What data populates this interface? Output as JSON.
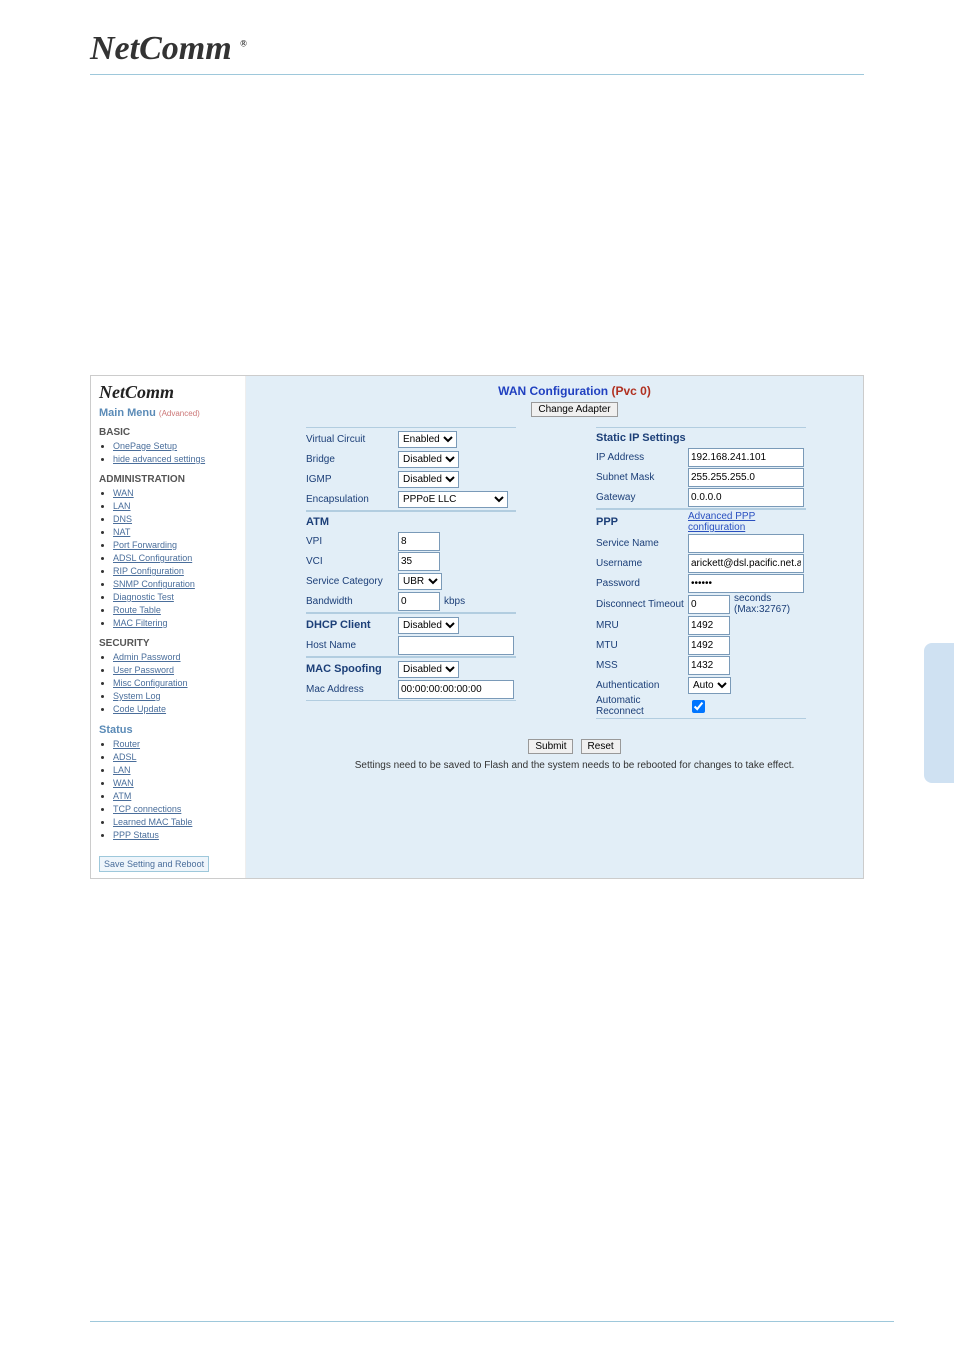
{
  "header": {
    "logo": "NetComm",
    "reg": "®"
  },
  "sidebar": {
    "logo": "NetComm",
    "mainmenu": "Main Menu",
    "adv": "(Advanced)",
    "basic_head": "BASIC",
    "basic": [
      {
        "label": "OnePage Setup"
      },
      {
        "label": "hide advanced settings"
      }
    ],
    "admin_head": "ADMINISTRATION",
    "admin": [
      {
        "label": "WAN"
      },
      {
        "label": "LAN"
      },
      {
        "label": "DNS"
      },
      {
        "label": "NAT"
      },
      {
        "label": "Port Forwarding"
      },
      {
        "label": "ADSL Configuration"
      },
      {
        "label": "RIP Configuration"
      },
      {
        "label": "SNMP Configuration"
      },
      {
        "label": "Diagnostic Test"
      },
      {
        "label": "Route Table"
      },
      {
        "label": "MAC Filtering"
      }
    ],
    "security_head": "SECURITY",
    "security": [
      {
        "label": "Admin Password"
      },
      {
        "label": "User Password"
      },
      {
        "label": "Misc Configuration"
      },
      {
        "label": "System Log"
      },
      {
        "label": "Code Update"
      }
    ],
    "status_head": "Status",
    "status": [
      {
        "label": "Router"
      },
      {
        "label": "ADSL"
      },
      {
        "label": "LAN"
      },
      {
        "label": "WAN"
      },
      {
        "label": "ATM"
      },
      {
        "label": "TCP connections"
      },
      {
        "label": "Learned MAC Table"
      },
      {
        "label": "PPP Status"
      }
    ],
    "save_btn": "Save Setting and Reboot"
  },
  "main": {
    "title1": "WAN Configuration ",
    "title2": "(Pvc 0)",
    "change_adapter": "Change Adapter",
    "left": {
      "g1": [
        {
          "label": "Virtual Circuit",
          "value": "Enabled",
          "type": "select"
        },
        {
          "label": "Bridge",
          "value": "Disabled",
          "type": "select"
        },
        {
          "label": "IGMP",
          "value": "Disabled",
          "type": "select"
        },
        {
          "label": "Encapsulation",
          "value": "PPPoE LLC",
          "type": "select",
          "wide": true
        }
      ],
      "g2_head": "ATM",
      "g2": [
        {
          "label": "VPI",
          "value": "8",
          "type": "text",
          "cls": "short"
        },
        {
          "label": "VCI",
          "value": "35",
          "type": "text",
          "cls": "short"
        },
        {
          "label": "Service Category",
          "value": "UBR",
          "type": "select"
        },
        {
          "label": "Bandwidth",
          "value": "0",
          "type": "text",
          "cls": "short",
          "suffix": "kbps"
        }
      ],
      "g3": [
        {
          "label": "DHCP Client",
          "value": "Disabled",
          "type": "select",
          "head": true
        },
        {
          "label": "Host Name",
          "value": "",
          "type": "text",
          "cls": "med"
        }
      ],
      "g4": [
        {
          "label": "MAC Spoofing",
          "value": "Disabled",
          "type": "select",
          "head": true
        },
        {
          "label": "Mac Address",
          "value": "00:00:00:00:00:00",
          "type": "text",
          "cls": "med"
        }
      ]
    },
    "right": {
      "g1_head": "Static IP Settings",
      "g1": [
        {
          "label": "IP Address",
          "value": "192.168.241.101",
          "type": "text",
          "cls": "med"
        },
        {
          "label": "Subnet Mask",
          "value": "255.255.255.0",
          "type": "text",
          "cls": "med"
        },
        {
          "label": "Gateway",
          "value": "0.0.0.0",
          "type": "text",
          "cls": "med"
        }
      ],
      "g2_head": "PPP",
      "g2_link": "Advanced PPP configuration",
      "g2": [
        {
          "label": "Service Name",
          "value": "",
          "type": "text",
          "cls": "med"
        },
        {
          "label": "Username",
          "value": "arickett@dsl.pacific.net.au",
          "type": "text",
          "cls": "med"
        },
        {
          "label": "Password",
          "value": "••••••",
          "type": "password",
          "cls": "med"
        },
        {
          "label": "Disconnect Timeout",
          "value": "0",
          "type": "text",
          "cls": "short",
          "suffix": "seconds (Max:32767)"
        },
        {
          "label": "MRU",
          "value": "1492",
          "type": "text",
          "cls": "short"
        },
        {
          "label": "MTU",
          "value": "1492",
          "type": "text",
          "cls": "short"
        },
        {
          "label": "MSS",
          "value": "1432",
          "type": "text",
          "cls": "short"
        },
        {
          "label": "Authentication",
          "value": "Auto",
          "type": "select"
        },
        {
          "label": "Automatic Reconnect",
          "value": "",
          "type": "checkbox"
        }
      ]
    },
    "submit": "Submit",
    "reset": "Reset",
    "footnote": "Settings need to be saved to Flash and the system needs to be rebooted for changes to take effect."
  }
}
